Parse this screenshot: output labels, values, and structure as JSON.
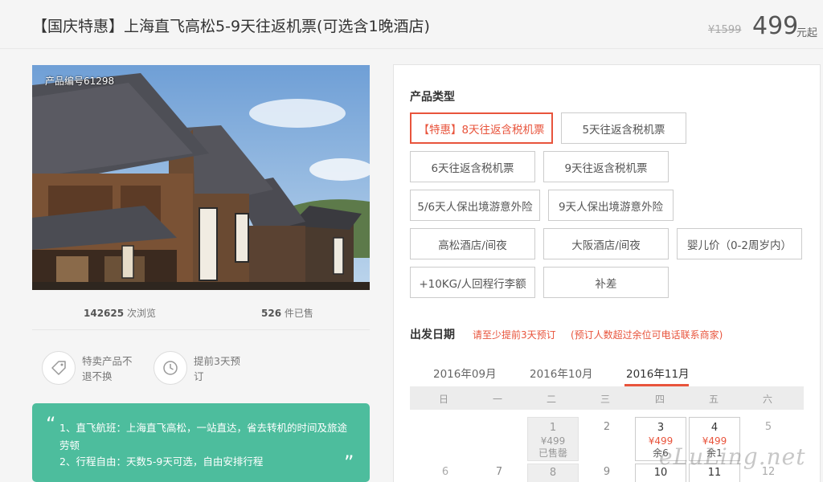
{
  "product": {
    "title": "【国庆特惠】上海直飞高松5-9天往返机票(可选含1晚酒店)",
    "price_old": "¥1599",
    "price_new": "499",
    "price_unit": "元起",
    "code": "产品编号61298"
  },
  "stats": {
    "views_num": "142625",
    "views_label": "次浏览",
    "sold_num": "526",
    "sold_label": "件已售"
  },
  "features": [
    {
      "text": "特卖产品不退不换",
      "icon": "tag-icon"
    },
    {
      "text": "提前3天预订",
      "icon": "clock-icon"
    }
  ],
  "highlights": {
    "line1": "1、直飞航班：上海直飞高松，一站直达，省去转机的时间及旅途劳顿",
    "line2": "2、行程自由：天数5-9天可选，自由安排行程"
  },
  "panel": {
    "type_label": "产品类型",
    "options": [
      "【特惠】8天往返含税机票",
      "5天往返含税机票",
      "6天往返含税机票",
      "9天往返含税机票",
      "5/6天人保出境游意外险",
      "9天人保出境游意外险",
      "高松酒店/间夜",
      "大阪酒店/间夜",
      "婴儿价（0-2周岁内）",
      "+10KG/人回程行李额",
      "补差"
    ],
    "date_label": "出发日期",
    "note1": "请至少提前3天预订",
    "note2": "(预订人数超过余位可电话联系商家)"
  },
  "calendar": {
    "months": [
      "2016年09月",
      "2016年10月",
      "2016年11月"
    ],
    "weekdays": [
      "日",
      "一",
      "二",
      "三",
      "四",
      "五",
      "六"
    ],
    "row1": [
      {
        "day": "1",
        "price": "¥499",
        "status": "已售罄"
      },
      {
        "day": "2"
      },
      {
        "day": "3",
        "price": "¥499",
        "status": "余6"
      },
      {
        "day": "4",
        "price": "¥499",
        "status": "余1"
      },
      {
        "day": "5"
      }
    ],
    "row2": [
      {
        "day": "6"
      },
      {
        "day": "7"
      },
      {
        "day": "8"
      },
      {
        "day": "9"
      },
      {
        "day": "10"
      },
      {
        "day": "11"
      },
      {
        "day": "12"
      }
    ]
  },
  "watermark": "eLuLing.net",
  "colors": {
    "accent": "#e8543c",
    "green": "#4dbd9d"
  }
}
